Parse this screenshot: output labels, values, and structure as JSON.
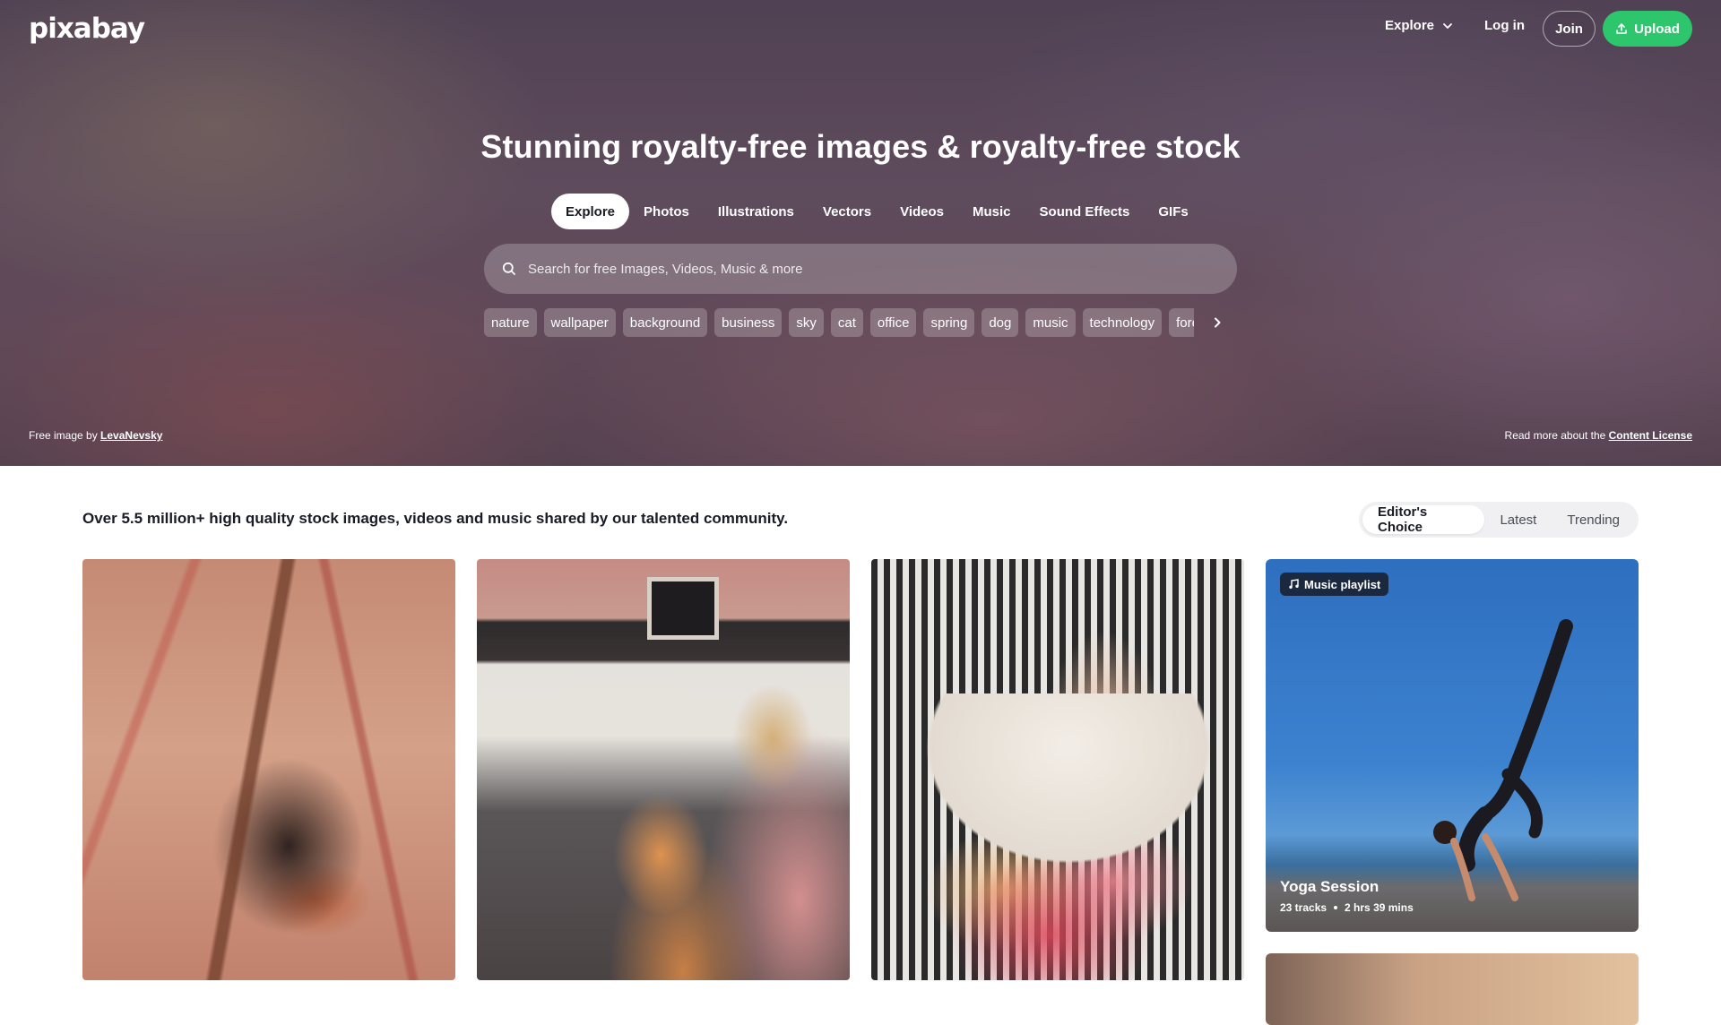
{
  "header": {
    "logo": "pixabay",
    "explore_label": "Explore",
    "login_label": "Log in",
    "join_label": "Join",
    "upload_label": "Upload",
    "upload_color": "#2ec66d"
  },
  "hero": {
    "title": "Stunning royalty-free images & royalty-free stock",
    "tabs": [
      {
        "label": "Explore",
        "active": true
      },
      {
        "label": "Photos"
      },
      {
        "label": "Illustrations"
      },
      {
        "label": "Vectors"
      },
      {
        "label": "Videos"
      },
      {
        "label": "Music"
      },
      {
        "label": "Sound Effects"
      },
      {
        "label": "GIFs"
      }
    ],
    "search": {
      "placeholder": "Search for free Images, Videos, Music & more",
      "value": ""
    },
    "chips": [
      "nature",
      "wallpaper",
      "background",
      "business",
      "sky",
      "cat",
      "office",
      "spring",
      "dog",
      "music",
      "technology",
      "forest"
    ],
    "credit": {
      "prefix": "Free image by",
      "author": "LevaNevsky"
    },
    "license": {
      "prefix": "Read more about the",
      "link": "Content License"
    }
  },
  "content": {
    "intro": "Over 5.5 million+ high quality stock images, videos and music shared by our talented community.",
    "sort_tabs": [
      {
        "label": "Editor's Choice",
        "active": true
      },
      {
        "label": "Latest"
      },
      {
        "label": "Trending"
      }
    ],
    "playlist": {
      "badge": "Music playlist",
      "title": "Yoga Session",
      "tracks": "23 tracks",
      "duration": "2 hrs 39 mins"
    }
  },
  "icons": {
    "chevron": "chevron-down-icon",
    "upload": "upload-icon",
    "search": "search-icon",
    "next": "chevron-right-icon",
    "music": "music-note-icon"
  }
}
